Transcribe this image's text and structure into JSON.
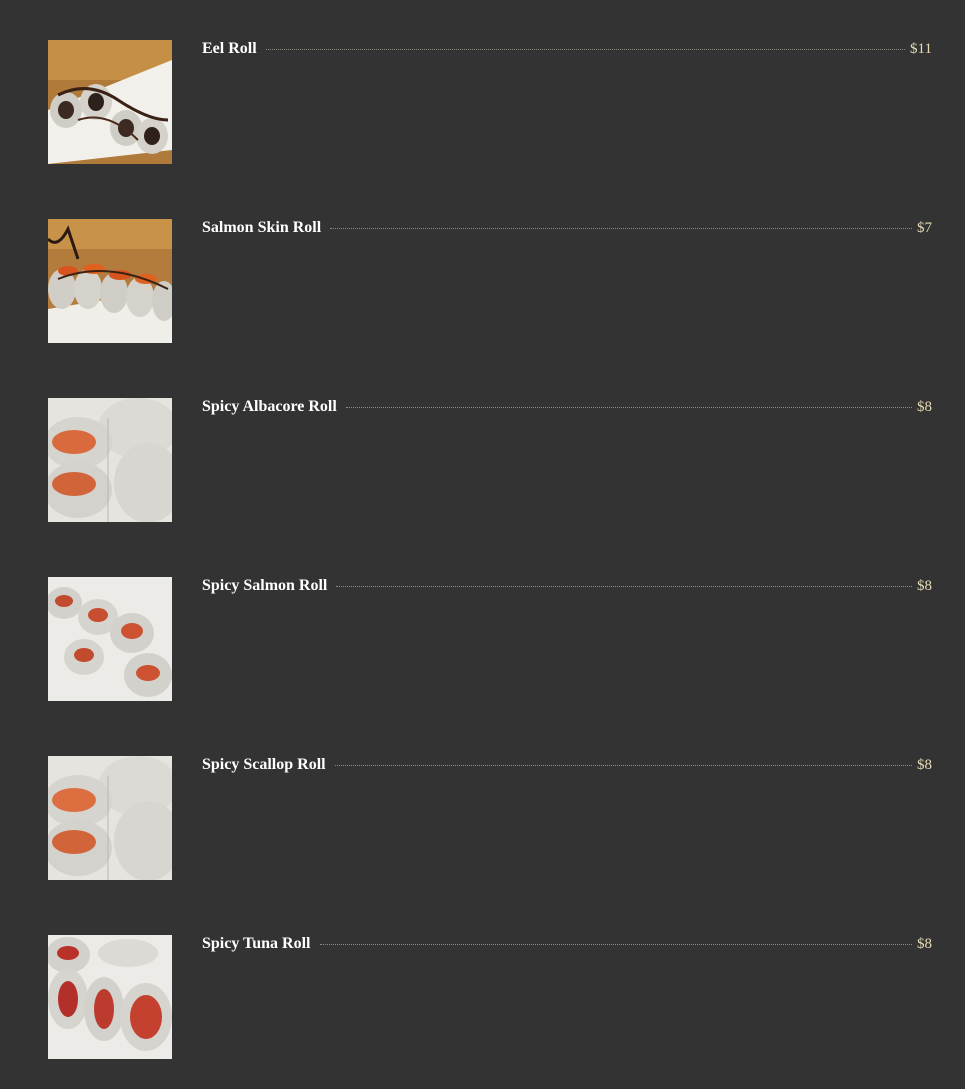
{
  "menu": {
    "items": [
      {
        "name": "Eel Roll",
        "price": "$11",
        "photo": "eel-roll-photo"
      },
      {
        "name": "Salmon Skin Roll",
        "price": "$7",
        "photo": "salmon-skin-roll-photo"
      },
      {
        "name": "Spicy Albacore Roll",
        "price": "$8",
        "photo": "spicy-albacore-roll-photo"
      },
      {
        "name": "Spicy Salmon Roll",
        "price": "$8",
        "photo": "spicy-salmon-roll-photo"
      },
      {
        "name": "Spicy Scallop Roll",
        "price": "$8",
        "photo": "spicy-scallop-roll-photo"
      },
      {
        "name": "Spicy Tuna Roll",
        "price": "$8",
        "photo": "spicy-tuna-roll-photo"
      }
    ]
  },
  "colors": {
    "background": "#333333",
    "item_name": "#ffffff",
    "price": "#e8dcb5",
    "leader_dots": "#8a8a80"
  }
}
